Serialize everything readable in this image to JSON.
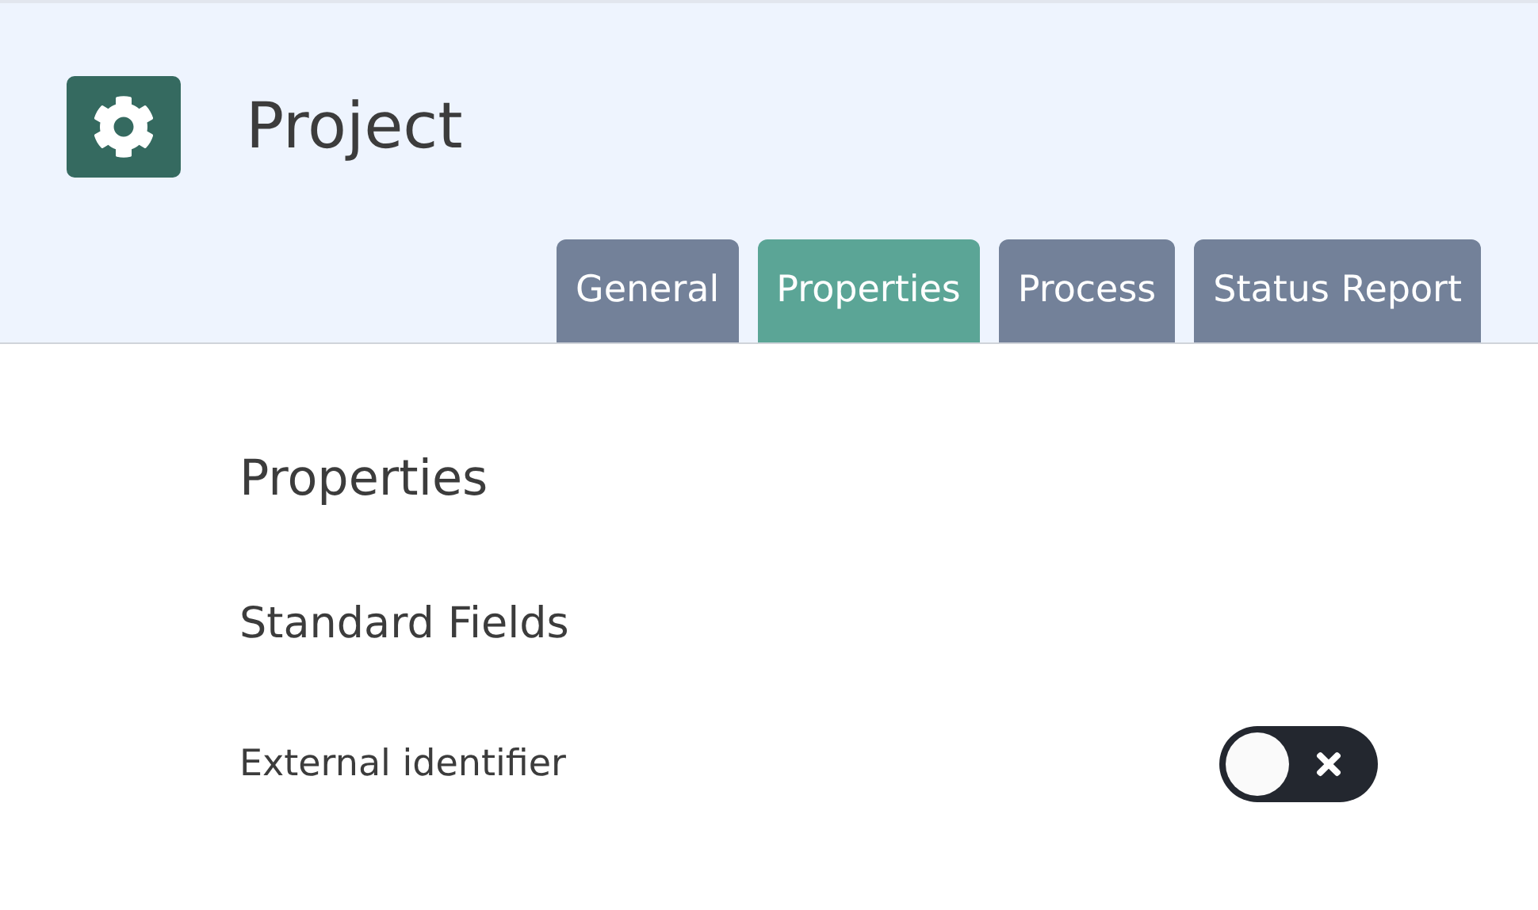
{
  "header": {
    "title": "Project"
  },
  "tabs": [
    {
      "label": "General",
      "selected": false
    },
    {
      "label": "Properties",
      "selected": true
    },
    {
      "label": "Process",
      "selected": false
    },
    {
      "label": "Status Report",
      "selected": false
    }
  ],
  "content": {
    "heading": "Properties",
    "section": "Standard Fields",
    "fields": [
      {
        "label": "External identifier",
        "on": false
      }
    ]
  }
}
